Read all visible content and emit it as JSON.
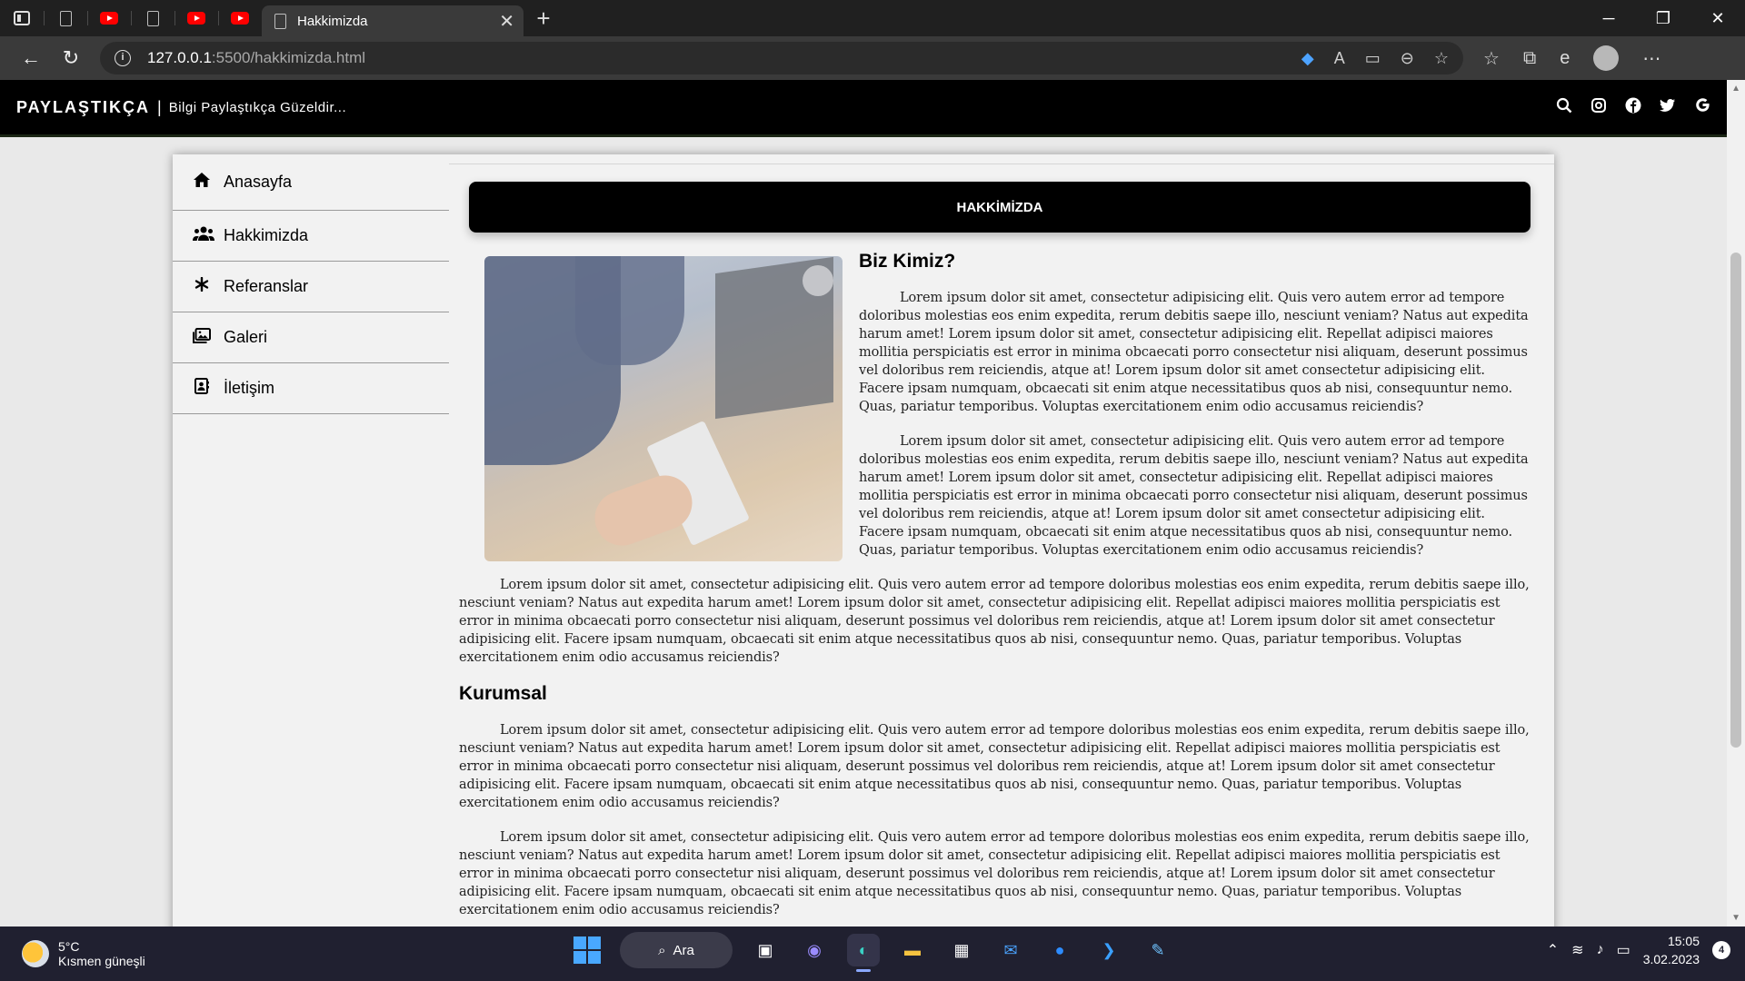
{
  "browser": {
    "active_tab_title": "Hakkimizda",
    "url_host": "127.0.0.1",
    "url_path": ":5500/hakkimizda.html",
    "new_tab_symbol": "+",
    "close_tab_symbol": "✕"
  },
  "site": {
    "brand": "PAYLAŞTIKÇA",
    "separator": "|",
    "tagline": "Bilgi Paylaştıkça Güzeldir..."
  },
  "sidebar": {
    "items": [
      {
        "label": "Anasayfa",
        "icon": "home-icon"
      },
      {
        "label": "Hakkimizda",
        "icon": "users-icon"
      },
      {
        "label": "Referanslar",
        "icon": "asterisk-icon"
      },
      {
        "label": "Galeri",
        "icon": "images-icon"
      },
      {
        "label": "İletişim",
        "icon": "contact-card-icon"
      }
    ]
  },
  "page": {
    "title_bar": "HAKKİMİZDA",
    "section1_heading": "Biz Kimiz?",
    "section2_heading": "Kurumsal",
    "lorem": "Lorem ipsum dolor sit amet, consectetur adipisicing elit. Quis vero autem error ad tempore doloribus molestias eos enim expedita, rerum debitis saepe illo, nesciunt veniam? Natus aut expedita harum amet! Lorem ipsum dolor sit amet, consectetur adipisicing elit. Repellat adipisci maiores mollitia perspiciatis est error in minima obcaecati porro consectetur nisi aliquam, deserunt possimus vel doloribus rem reiciendis, atque at! Lorem ipsum dolor sit amet consectetur adipisicing elit. Facere ipsam numquam, obcaecati sit enim atque necessitatibus quos ab nisi, consequuntur nemo. Quas, pariatur temporibus. Voluptas exercitationem enim odio accusamus reiciendis?"
  },
  "taskbar": {
    "temperature": "5°C",
    "weather": "Kısmen güneşli",
    "search_label": "Ara",
    "time": "15:05",
    "date": "3.02.2023",
    "notification_count": "4"
  },
  "colors": {
    "header_bg": "#000000",
    "title_bar_bg": "#000000",
    "page_bg": "#e9e9e9",
    "card_bg": "#f2f2f2"
  }
}
